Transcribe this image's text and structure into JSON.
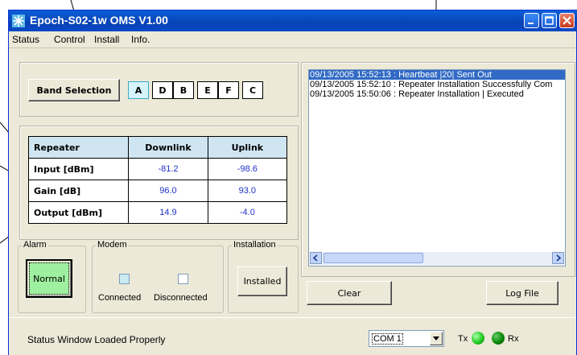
{
  "window": {
    "title": "Epoch-S02-1w OMS V1.00"
  },
  "menu": [
    "Status",
    "Control",
    "Install",
    "Info."
  ],
  "band": {
    "button_label": "Band Selection",
    "options": [
      "A",
      "D",
      "B",
      "E",
      "F",
      "C"
    ],
    "selected": "A"
  },
  "repeater_table": {
    "headers": [
      "Repeater",
      "Downlink",
      "Uplink"
    ],
    "rows": [
      {
        "label": "Input [dBm]",
        "downlink": "-81.2",
        "uplink": "-98.6"
      },
      {
        "label": "Gain [dB]",
        "downlink": "96.0",
        "uplink": "93.0"
      },
      {
        "label": "Output [dBm]",
        "downlink": "14.9",
        "uplink": "-4.0"
      }
    ]
  },
  "alarm": {
    "group_label": "Alarm",
    "button_label": "Normal",
    "color": "#9ef0a0"
  },
  "modem": {
    "group_label": "Modem",
    "connected_label": "Connected",
    "disconnected_label": "Disconnected"
  },
  "installation": {
    "group_label": "Installation",
    "button_label": "Installed"
  },
  "log": {
    "lines": [
      "09/13/2005 15:52:13 : Heartbeat |20| Sent Out",
      "09/13/2005 15:52:10 : Repeater Installation Successfully Com",
      "09/13/2005 15:50:06 : Repeater Installation | Executed"
    ],
    "selected_index": 0
  },
  "buttons": {
    "clear": "Clear",
    "log_file": "Log File"
  },
  "statusbar": {
    "message": "Status Window Loaded Properly",
    "port": "COM 1",
    "tx_label": "Tx",
    "rx_label": "Rx",
    "tx_color": "#22cc22",
    "rx_color": "#0a8a0a"
  }
}
